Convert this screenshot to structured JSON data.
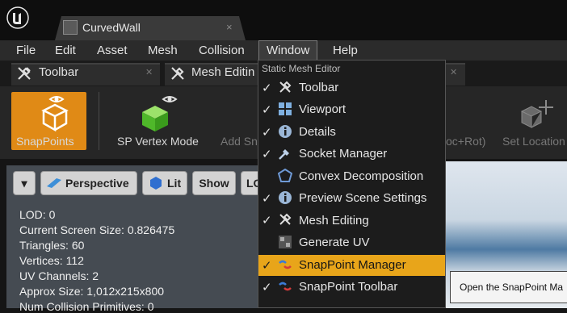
{
  "window": {
    "tab_title": "CurvedWall",
    "tab_close": "×"
  },
  "menubar": {
    "items": [
      "File",
      "Edit",
      "Asset",
      "Mesh",
      "Collision",
      "Window",
      "Help"
    ],
    "active": "Window"
  },
  "panel_tabs": [
    {
      "label": "Toolbar",
      "icon": "wrench-icon"
    },
    {
      "label": "Mesh Editin",
      "icon": "wrench-icon"
    }
  ],
  "toolbar": {
    "snappoints_label": "SnapPoints",
    "sp_vertex_label": "SP Vertex Mode",
    "add_sn_label": "Add Sn",
    "loc_rot_label": "oc+Rot)",
    "set_location_label": "Set Location",
    "accent_color": "#e08a16"
  },
  "viewport": {
    "buttons": {
      "menu": "▾",
      "perspective": "Perspective",
      "lit": "Lit",
      "show": "Show",
      "lod": "LO"
    },
    "stats": [
      "LOD:  0",
      "Current Screen Size:  0.826475",
      "Triangles:  60",
      "Vertices:  112",
      "UV Channels:  2",
      "Approx Size: 1,012x215x800",
      "Num Collision Primitives:  0"
    ]
  },
  "window_menu": {
    "header": "Static Mesh Editor",
    "items": [
      {
        "label": "Toolbar",
        "checked": true,
        "icon": "wrench-icon"
      },
      {
        "label": "Viewport",
        "checked": true,
        "icon": "viewport-grid-icon"
      },
      {
        "label": "Details",
        "checked": true,
        "icon": "info-icon"
      },
      {
        "label": "Socket Manager",
        "checked": true,
        "icon": "socket-icon"
      },
      {
        "label": "Convex Decomposition",
        "checked": false,
        "icon": "convex-icon"
      },
      {
        "label": "Preview Scene Settings",
        "checked": true,
        "icon": "info-icon"
      },
      {
        "label": "Mesh Editing",
        "checked": true,
        "icon": "wrench-icon"
      },
      {
        "label": "Generate UV",
        "checked": false,
        "icon": "uv-icon"
      },
      {
        "label": "SnapPoint Manager",
        "checked": true,
        "icon": "snappoint-icon",
        "highlighted": true
      },
      {
        "label": "SnapPoint Toolbar",
        "checked": true,
        "icon": "snappoint-icon"
      }
    ],
    "check_glyph": "✓",
    "highlight_color": "#e8a51a"
  },
  "tooltip": {
    "text": "Open the SnapPoint Ma"
  }
}
